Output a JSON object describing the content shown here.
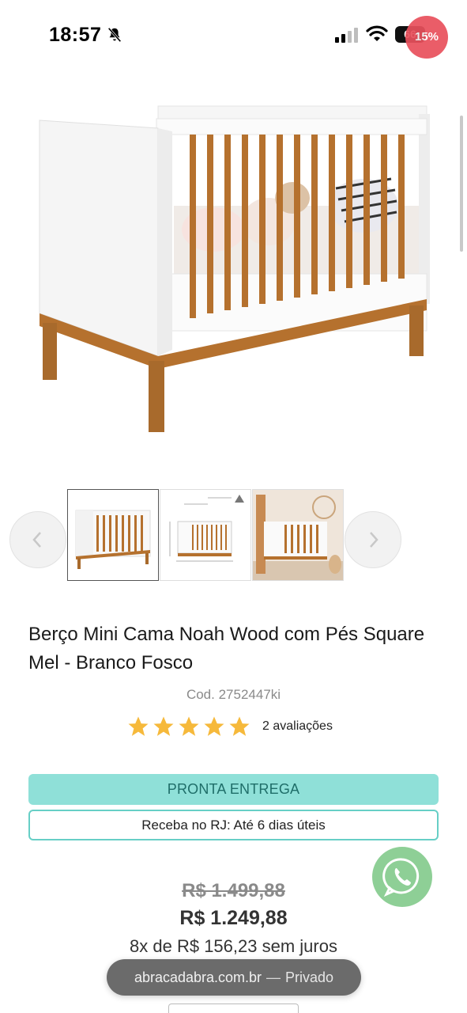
{
  "status_bar": {
    "time": "18:57",
    "battery": "66",
    "recording_badge": "15%"
  },
  "gallery": {
    "thumbnails": [
      "berco-frente",
      "berco-medidas",
      "berco-ambiente"
    ]
  },
  "product": {
    "title": "Berço Mini Cama Noah Wood com Pés Square Mel - Branco Fosco",
    "code": "Cod. 2752447ki",
    "rating": 5,
    "reviews": "2 avaliações",
    "availability": "PRONTA ENTREGA",
    "delivery": "Receba no RJ: Até 6 dias úteis",
    "old_price": "R$ 1.499,88",
    "price": "R$ 1.249,88",
    "installments": "8x de R$ 156,23 sem juros"
  },
  "browser": {
    "domain": "abracadabra.com.br",
    "separator": "—",
    "mode": "Privado"
  },
  "colors": {
    "accent_teal": "#8fe0d8",
    "teal_border": "#67cfc6",
    "star": "#f6b93b",
    "wood": "#b5712e",
    "whatsapp": "#8ecf96"
  },
  "icons": {
    "bell": "bell-slash-icon",
    "signal": "cellular-signal-icon",
    "wifi": "wifi-icon",
    "prev": "chevron-left-icon",
    "next": "chevron-right-icon",
    "whatsapp": "whatsapp-phone-icon"
  }
}
